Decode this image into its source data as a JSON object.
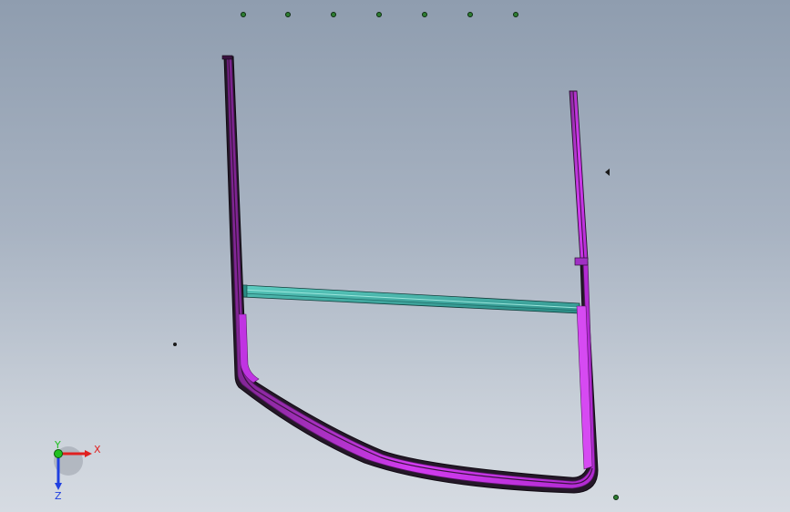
{
  "viewport": {
    "background_top": "#8f9daf",
    "background_bottom": "#d6dbe2"
  },
  "model": {
    "frame_color": "#cc33ee",
    "frame_shade": "#6a1f7a",
    "frame_edge": "#1a1420",
    "crossbar_color": "#3fb3a8",
    "crossbar_shade": "#1f6f6a",
    "point_marker_color": "#2e7d32"
  },
  "triad": {
    "x_label": "X",
    "y_label": "Y",
    "z_label": "Z",
    "x_color": "#e02020",
    "y_color": "#20c020",
    "z_color": "#2040e0"
  }
}
